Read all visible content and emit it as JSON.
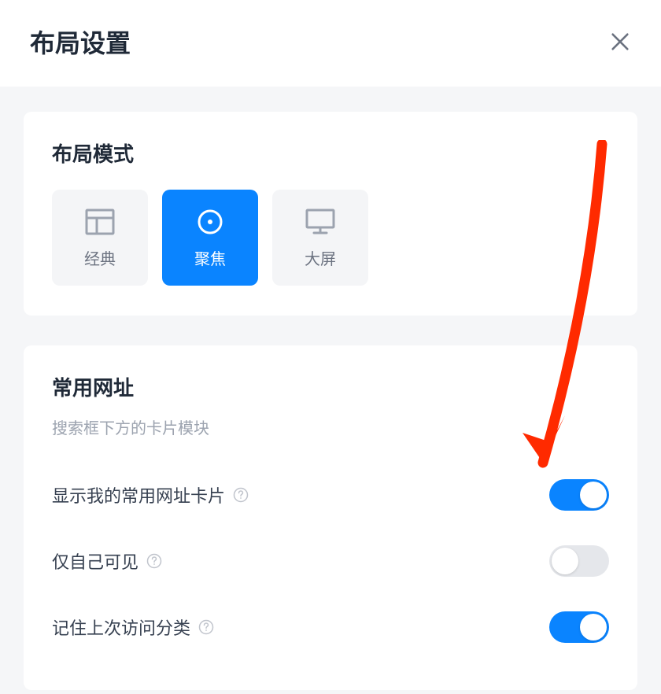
{
  "header": {
    "title": "布局设置"
  },
  "layout_mode": {
    "title": "布局模式",
    "options": [
      {
        "label": "经典",
        "icon": "layout-classic-icon",
        "active": false
      },
      {
        "label": "聚焦",
        "icon": "layout-focus-icon",
        "active": true
      },
      {
        "label": "大屏",
        "icon": "layout-widescreen-icon",
        "active": false
      }
    ]
  },
  "common_sites": {
    "title": "常用网址",
    "subtitle": "搜索框下方的卡片模块",
    "settings": [
      {
        "label": "显示我的常用网址卡片",
        "on": true
      },
      {
        "label": "仅自己可见",
        "on": false
      },
      {
        "label": "记住上次访问分类",
        "on": true
      }
    ]
  },
  "annotation": {
    "arrow_color": "#ff2a00"
  }
}
